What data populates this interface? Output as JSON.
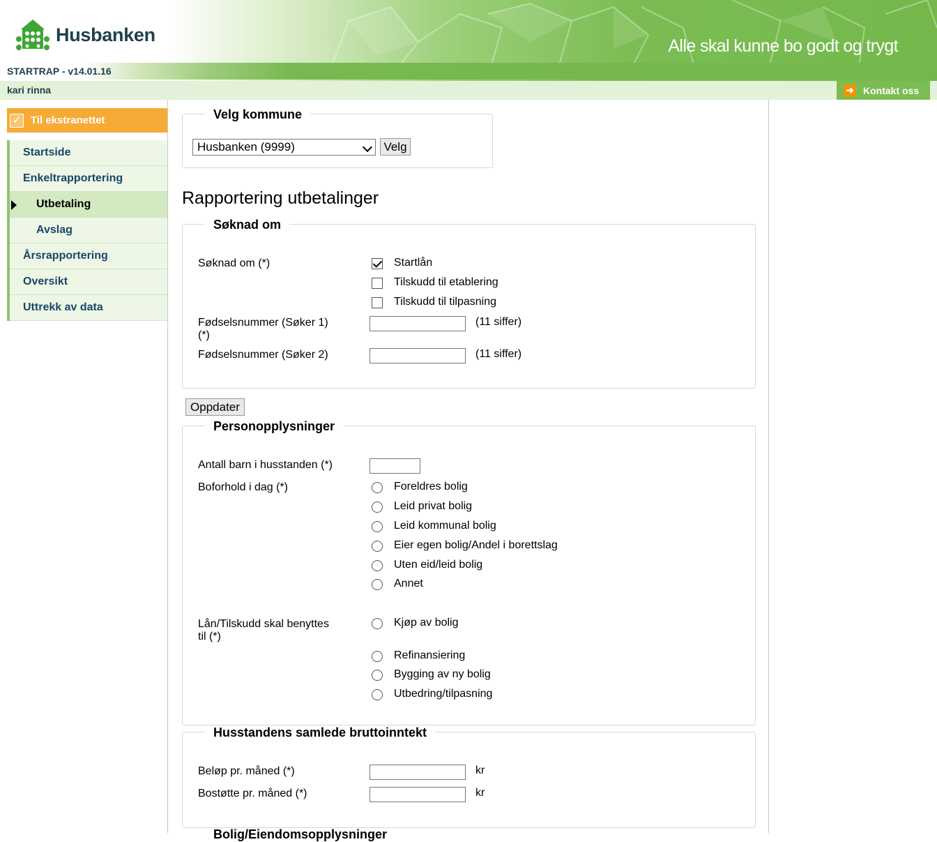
{
  "header": {
    "logo_text": "Husbanken",
    "tagline": "Alle skal kunne bo godt og trygt",
    "version": "STARTRAP - v14.01.16",
    "user": "kari rinna",
    "contact_label": "Kontakt oss"
  },
  "sidebar": {
    "extranet_label": "Til ekstranettet",
    "items": [
      {
        "label": "Startside"
      },
      {
        "label": "Enkeltrapportering"
      },
      {
        "label": "Utbetaling"
      },
      {
        "label": "Avslag"
      },
      {
        "label": "Årsrapportering"
      },
      {
        "label": "Oversikt"
      },
      {
        "label": "Uttrekk av data"
      }
    ]
  },
  "kommune": {
    "legend": "Velg kommune",
    "selected": "Husbanken (9999)",
    "button": "Velg"
  },
  "page_title": "Rapportering utbetalinger",
  "soknad": {
    "legend": "Søknad om",
    "label": "Søknad om (*)",
    "options": [
      {
        "label": "Startlån",
        "checked": true
      },
      {
        "label": "Tilskudd til etablering",
        "checked": false
      },
      {
        "label": "Tilskudd til tilpasning",
        "checked": false
      }
    ],
    "fnr1_label_line1": "Fødselsnummer (Søker 1)",
    "fnr1_label_line2": "(*)",
    "fnr1_hint": "(11 siffer)",
    "fnr1_value": "",
    "fnr2_label": "Fødselsnummer (Søker 2)",
    "fnr2_hint": "(11 siffer)",
    "fnr2_value": ""
  },
  "update_button": "Oppdater",
  "person": {
    "legend": "Personopplysninger",
    "barn_label": "Antall barn i husstanden (*)",
    "barn_value": "",
    "boforhold_label": "Boforhold i dag (*)",
    "boforhold_options": [
      "Foreldres bolig",
      "Leid privat bolig",
      "Leid kommunal bolig",
      "Eier egen bolig/Andel i borettslag",
      "Uten eid/leid bolig",
      "Annet"
    ],
    "bruk_label_line1": "Lån/Tilskudd skal benyttes",
    "bruk_label_line2": "til (*)",
    "bruk_options": [
      "Kjøp av bolig",
      "Refinansiering",
      "Bygging av ny bolig",
      "Utbedring/tilpasning"
    ]
  },
  "inntekt": {
    "legend": "Husstandens samlede bruttoinntekt",
    "belop_label": "Beløp pr. måned (*)",
    "belop_unit": "kr",
    "belop_value": "",
    "bostotte_label": "Bostøtte pr. måned (*)",
    "bostotte_unit": "kr",
    "bostotte_value": ""
  },
  "next_legend_partial": "Bolig/Eiendomsopplysninger"
}
